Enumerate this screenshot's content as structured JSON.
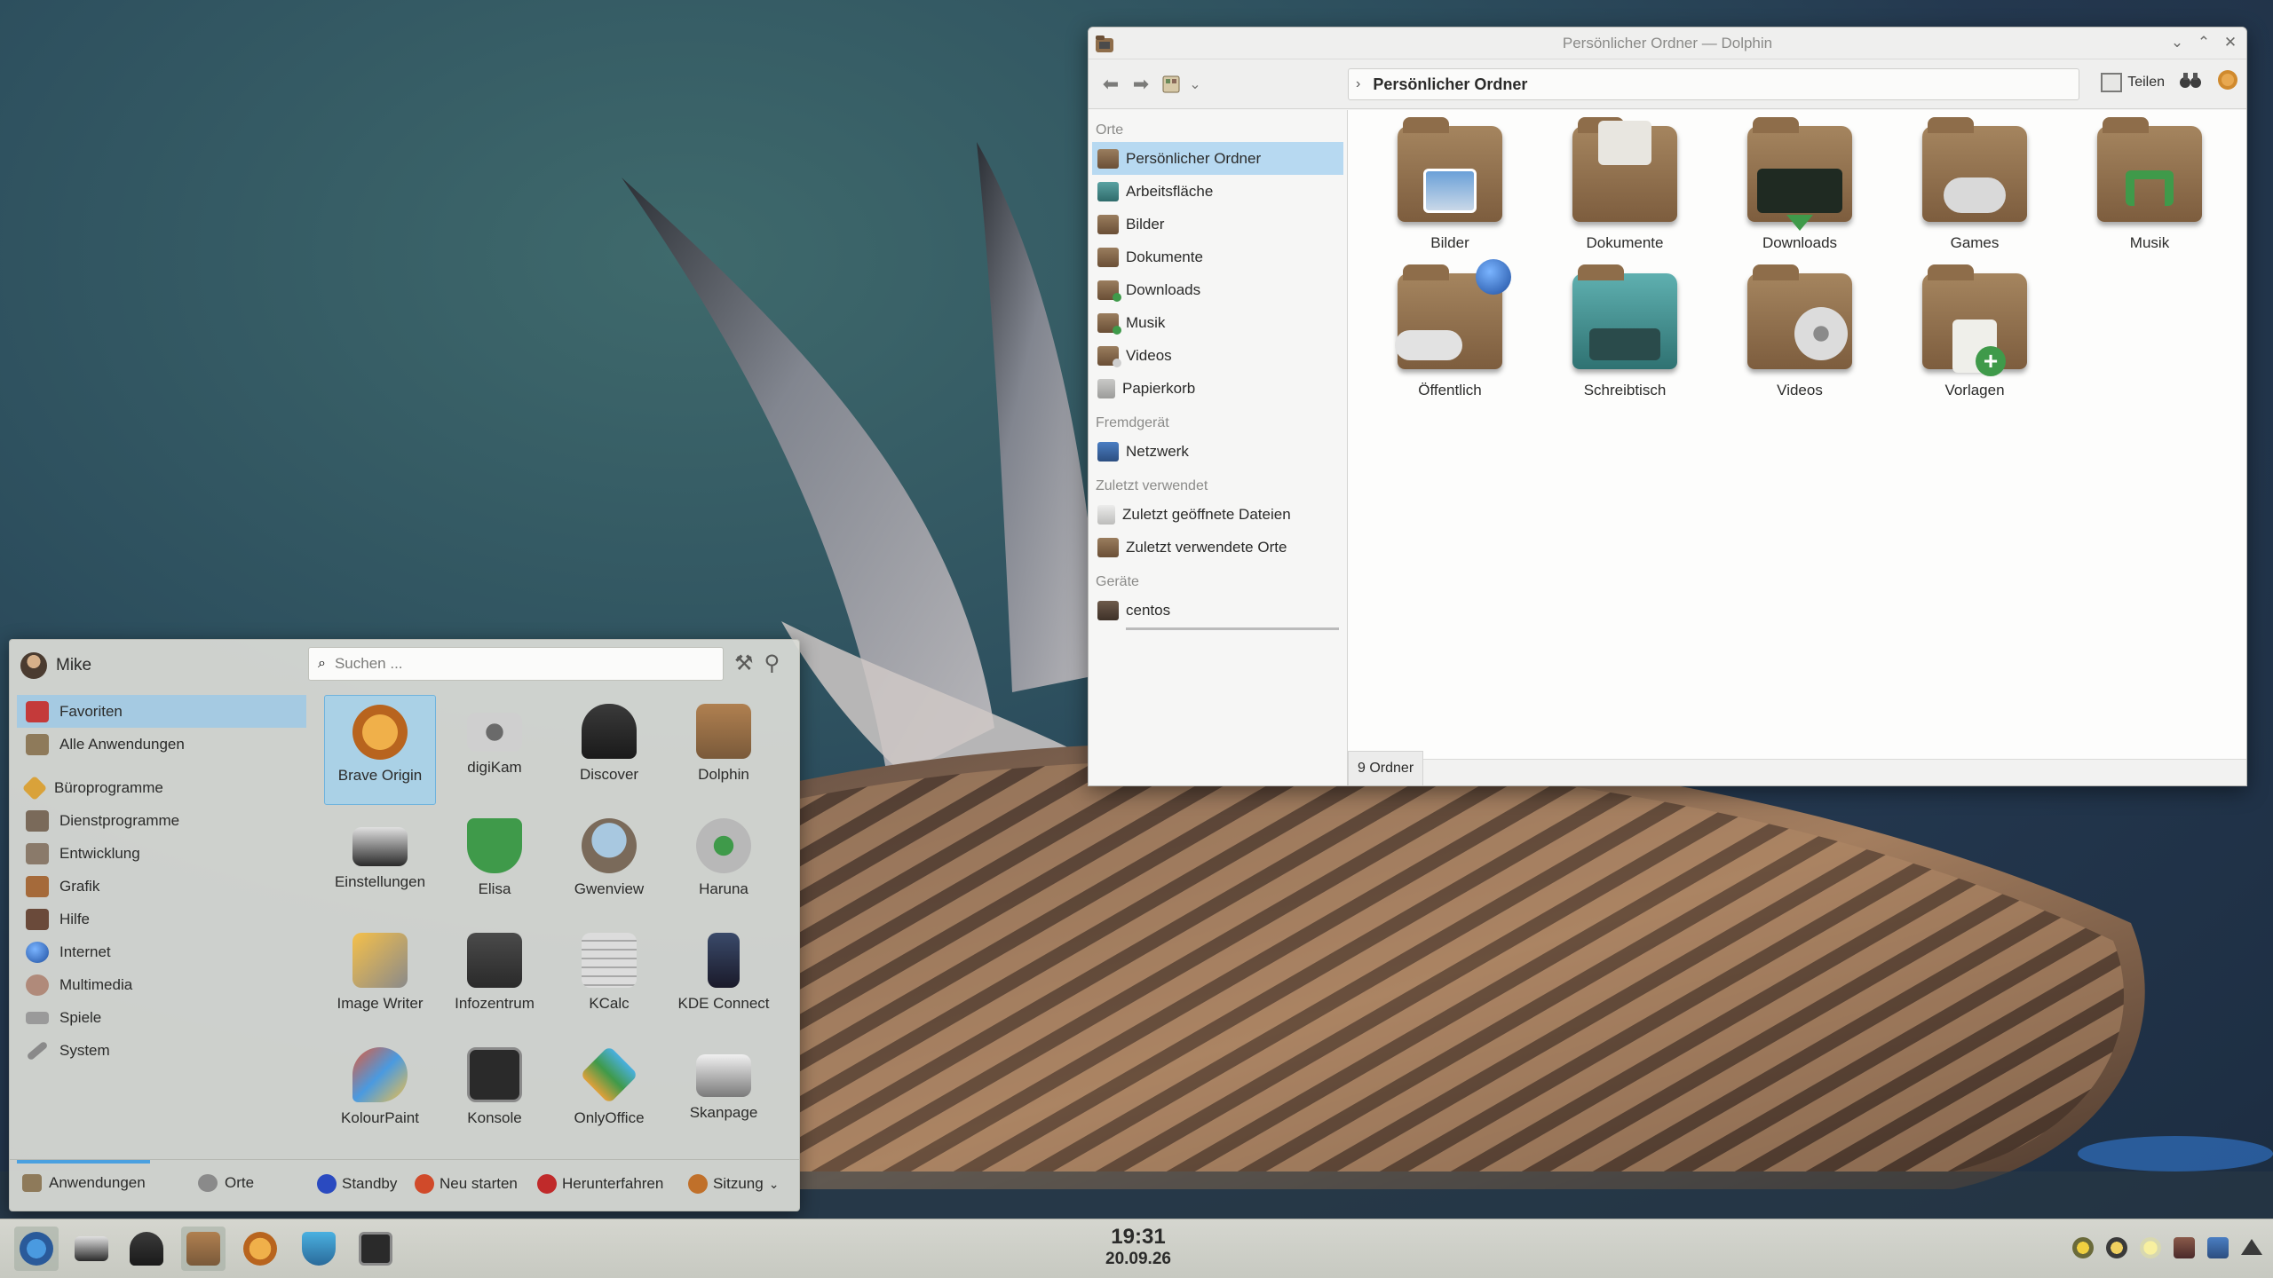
{
  "dolphin": {
    "title": "Persönlicher Ordner — Dolphin",
    "breadcrumb": "Persönlicher Ordner",
    "share_label": "Teilen",
    "status": "9 Ordner",
    "places": {
      "orte_label": "Orte",
      "orte": [
        "Persönlicher Ordner",
        "Arbeitsfläche",
        "Bilder",
        "Dokumente",
        "Downloads",
        "Musik",
        "Videos",
        "Papierkorb"
      ],
      "remote_label": "Fremdgerät",
      "remote": [
        "Netzwerk"
      ],
      "recent_label": "Zuletzt verwendet",
      "recent": [
        "Zuletzt geöffnete Dateien",
        "Zuletzt verwendete Orte"
      ],
      "devices_label": "Geräte",
      "devices": [
        "centos"
      ]
    },
    "folders": [
      "Bilder",
      "Dokumente",
      "Downloads",
      "Games",
      "Musik",
      "Öffentlich",
      "Schreibtisch",
      "Videos",
      "Vorlagen"
    ]
  },
  "kickoff": {
    "user": "Mike",
    "search_placeholder": "Suchen ...",
    "categories": [
      "Favoriten",
      "Alle Anwendungen",
      "Büroprogramme",
      "Dienstprogramme",
      "Entwicklung",
      "Grafik",
      "Hilfe",
      "Internet",
      "Multimedia",
      "Spiele",
      "System"
    ],
    "apps": [
      "Brave Origin",
      "digiKam",
      "Discover",
      "Dolphin",
      "Einstellungen",
      "Elisa",
      "Gwenview",
      "Haruna",
      "Image Writer",
      "Infozentrum",
      "KCalc",
      "KDE Connect",
      "KolourPaint",
      "Konsole",
      "OnlyOffice",
      "Skanpage"
    ],
    "footer": {
      "apps_tab": "Anwendungen",
      "places_tab": "Orte",
      "standby": "Standby",
      "restart": "Neu starten",
      "shutdown": "Herunterfahren",
      "session": "Sitzung"
    }
  },
  "taskbar": {
    "time": "19:31",
    "date": "20.09.26"
  },
  "colors": {
    "selection": "#b7d9f1",
    "accent": "#4aa0e0",
    "folder": "#8e6d4a"
  }
}
